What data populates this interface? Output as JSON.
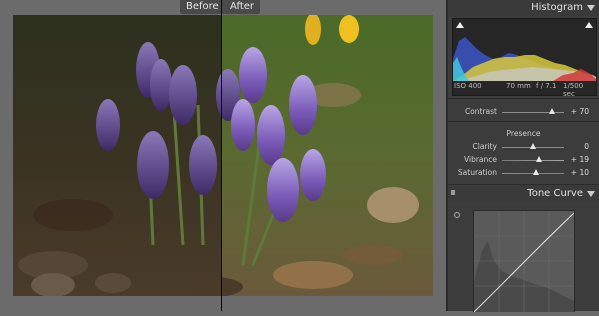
{
  "preview": {
    "before_label": "Before",
    "after_label": "After"
  },
  "histogram": {
    "title": "Histogram",
    "iso": "ISO 400",
    "focal_length": "70 mm",
    "aperture": "f / 7.1",
    "shutter": "1/500 sec"
  },
  "basic": {
    "contrast_label": "Contrast",
    "contrast_value": "+ 70",
    "contrast_level": 0.8
  },
  "presence": {
    "title": "Presence",
    "clarity_label": "Clarity",
    "clarity_value": "0",
    "clarity_level": 0.5,
    "vibrance_label": "Vibrance",
    "vibrance_value": "+ 19",
    "vibrance_level": 0.6,
    "saturation_label": "Saturation",
    "saturation_value": "+ 10",
    "saturation_level": 0.55
  },
  "tone_curve": {
    "title": "Tone Curve"
  },
  "colors": {
    "panel_bg": "#3c3c3c",
    "accent_track": "#8c8c8c"
  }
}
